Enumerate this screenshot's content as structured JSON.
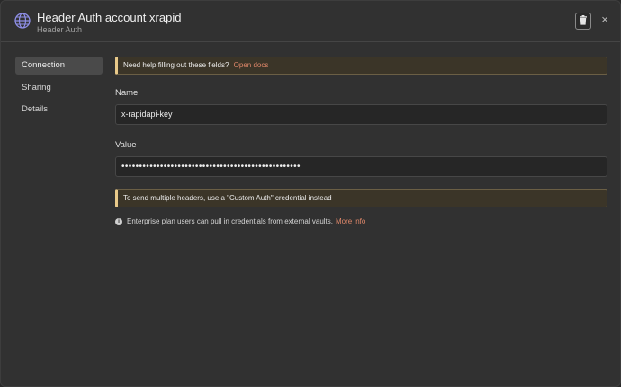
{
  "header": {
    "title": "Header Auth account xrapid",
    "subtitle": "Header Auth",
    "icon": "globe-icon",
    "delete_icon": "trash-icon",
    "close_label": "×"
  },
  "sidebar": {
    "items": [
      {
        "label": "Connection",
        "active": true
      },
      {
        "label": "Sharing",
        "active": false
      },
      {
        "label": "Details",
        "active": false
      }
    ]
  },
  "main": {
    "help_callout": {
      "text": "Need help filling out these fields?",
      "link": "Open docs"
    },
    "name_field": {
      "label": "Name",
      "value": "x-rapidapi-key"
    },
    "value_field": {
      "label": "Value",
      "value": "•••••••••••••••••••••••••••••••••••••••••••••••••••"
    },
    "warning_callout": {
      "text": "To send multiple headers, use a \"Custom Auth\" credential instead"
    },
    "enterprise_note": {
      "text": "Enterprise plan users can pull in credentials from external vaults.",
      "link": "More info"
    }
  },
  "colors": {
    "background": "#313131",
    "accent_link": "#e0886a",
    "callout_border": "#e8c98a",
    "globe": "#8f8fe8"
  }
}
